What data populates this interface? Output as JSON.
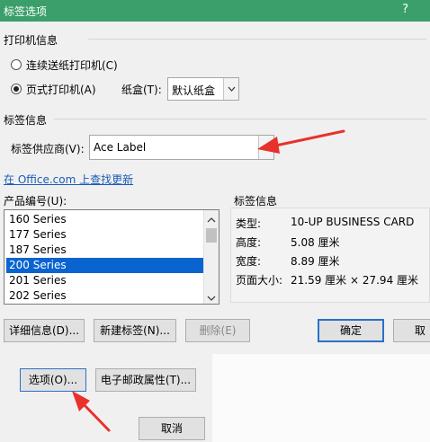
{
  "title": "标签选项",
  "help_glyph": "?",
  "printer_info": {
    "group_label": "打印机信息",
    "continuous": "连续送纸打印机(C)",
    "page": "页式打印机(A)",
    "tray_label": "纸盒(T):",
    "tray_value": "默认纸盒",
    "selected": "page"
  },
  "label_info": {
    "group_label": "标签信息",
    "vendor_label": "标签供应商(V):",
    "vendor_value": "Ace Label",
    "online_link": "在 Office.com 上查找更新"
  },
  "product": {
    "label": "产品编号(U):",
    "items": [
      "160 Series",
      "177 Series",
      "187 Series",
      "200 Series",
      "201 Series",
      "202 Series"
    ],
    "selected_index": 3
  },
  "details": {
    "group_label": "标签信息",
    "rows": [
      {
        "key": "类型:",
        "value": "10-UP BUSINESS CARD"
      },
      {
        "key": "高度:",
        "value": "5.08 厘米"
      },
      {
        "key": "宽度:",
        "value": "8.89 厘米"
      },
      {
        "key": "页面大小:",
        "value": "21.59 厘米 × 27.94 厘米"
      }
    ]
  },
  "buttons": {
    "details": "详细信息(D)...",
    "new_label": "新建标签(N)...",
    "delete": "删除(E)",
    "ok": "确定",
    "cancel_partial": "取"
  },
  "background_dialog": {
    "options": "选项(O)...",
    "postal": "电子邮政属性(T)...",
    "cancel": "取消"
  },
  "colors": {
    "titlebar": "#3a9f6a",
    "selection": "#0a64d0",
    "link": "#1a5bb8",
    "arrow": "#e8312b"
  },
  "icons": {
    "dropdown": "chevron-down-icon",
    "scroll_up": "scroll-up-icon",
    "scroll_down": "scroll-down-icon"
  }
}
